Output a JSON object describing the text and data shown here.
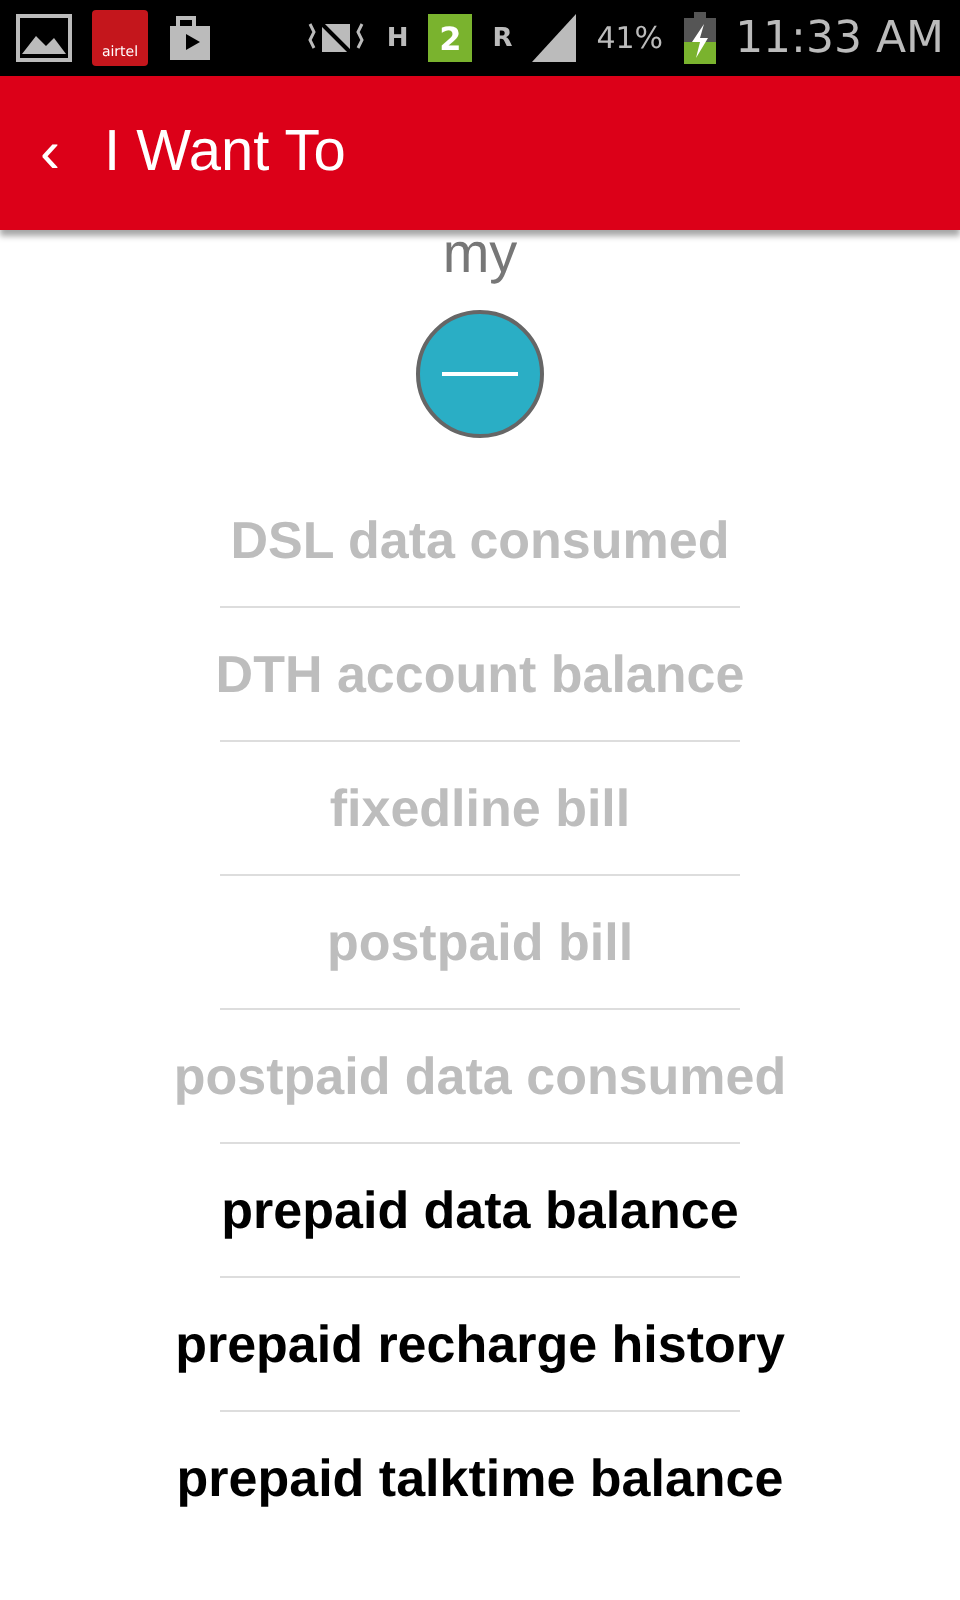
{
  "status_bar": {
    "carrier_logo": "airtel",
    "network_type": "H",
    "sim_badge": "2",
    "roaming": "R",
    "battery": "41%",
    "time": "11:33 AM"
  },
  "app_bar": {
    "back": "‹",
    "title": "I Want To"
  },
  "prompt": "my",
  "collapse_button": {
    "expanded": true
  },
  "options": [
    {
      "label": "DSL data consumed",
      "disabled": true
    },
    {
      "label": "DTH account balance",
      "disabled": true
    },
    {
      "label": "fixedline bill",
      "disabled": true
    },
    {
      "label": "postpaid bill",
      "disabled": true
    },
    {
      "label": "postpaid data consumed",
      "disabled": true
    },
    {
      "label": "prepaid data balance",
      "disabled": false
    },
    {
      "label": "prepaid recharge history",
      "disabled": false
    },
    {
      "label": "prepaid talktime balance",
      "disabled": false
    }
  ]
}
